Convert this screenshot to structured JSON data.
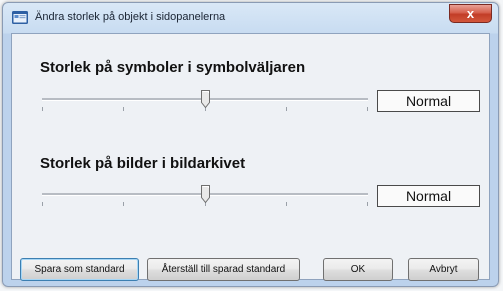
{
  "window": {
    "title": "Ändra storlek på objekt i sidopanelerna",
    "close_label": "x"
  },
  "sections": [
    {
      "title": "Storlek på symboler i symbolväljaren",
      "slider_level": 0.5,
      "value": "Normal"
    },
    {
      "title": "Storlek på bilder i bildarkivet",
      "slider_level": 0.5,
      "value": "Normal"
    }
  ],
  "buttons": {
    "save_default": "Spara som standard",
    "restore_default": "Återställ till sparad standard",
    "ok": "OK",
    "cancel": "Avbryt"
  },
  "colors": {
    "close_button": "#c94a33",
    "default_button_border": "#3c7fb1"
  }
}
